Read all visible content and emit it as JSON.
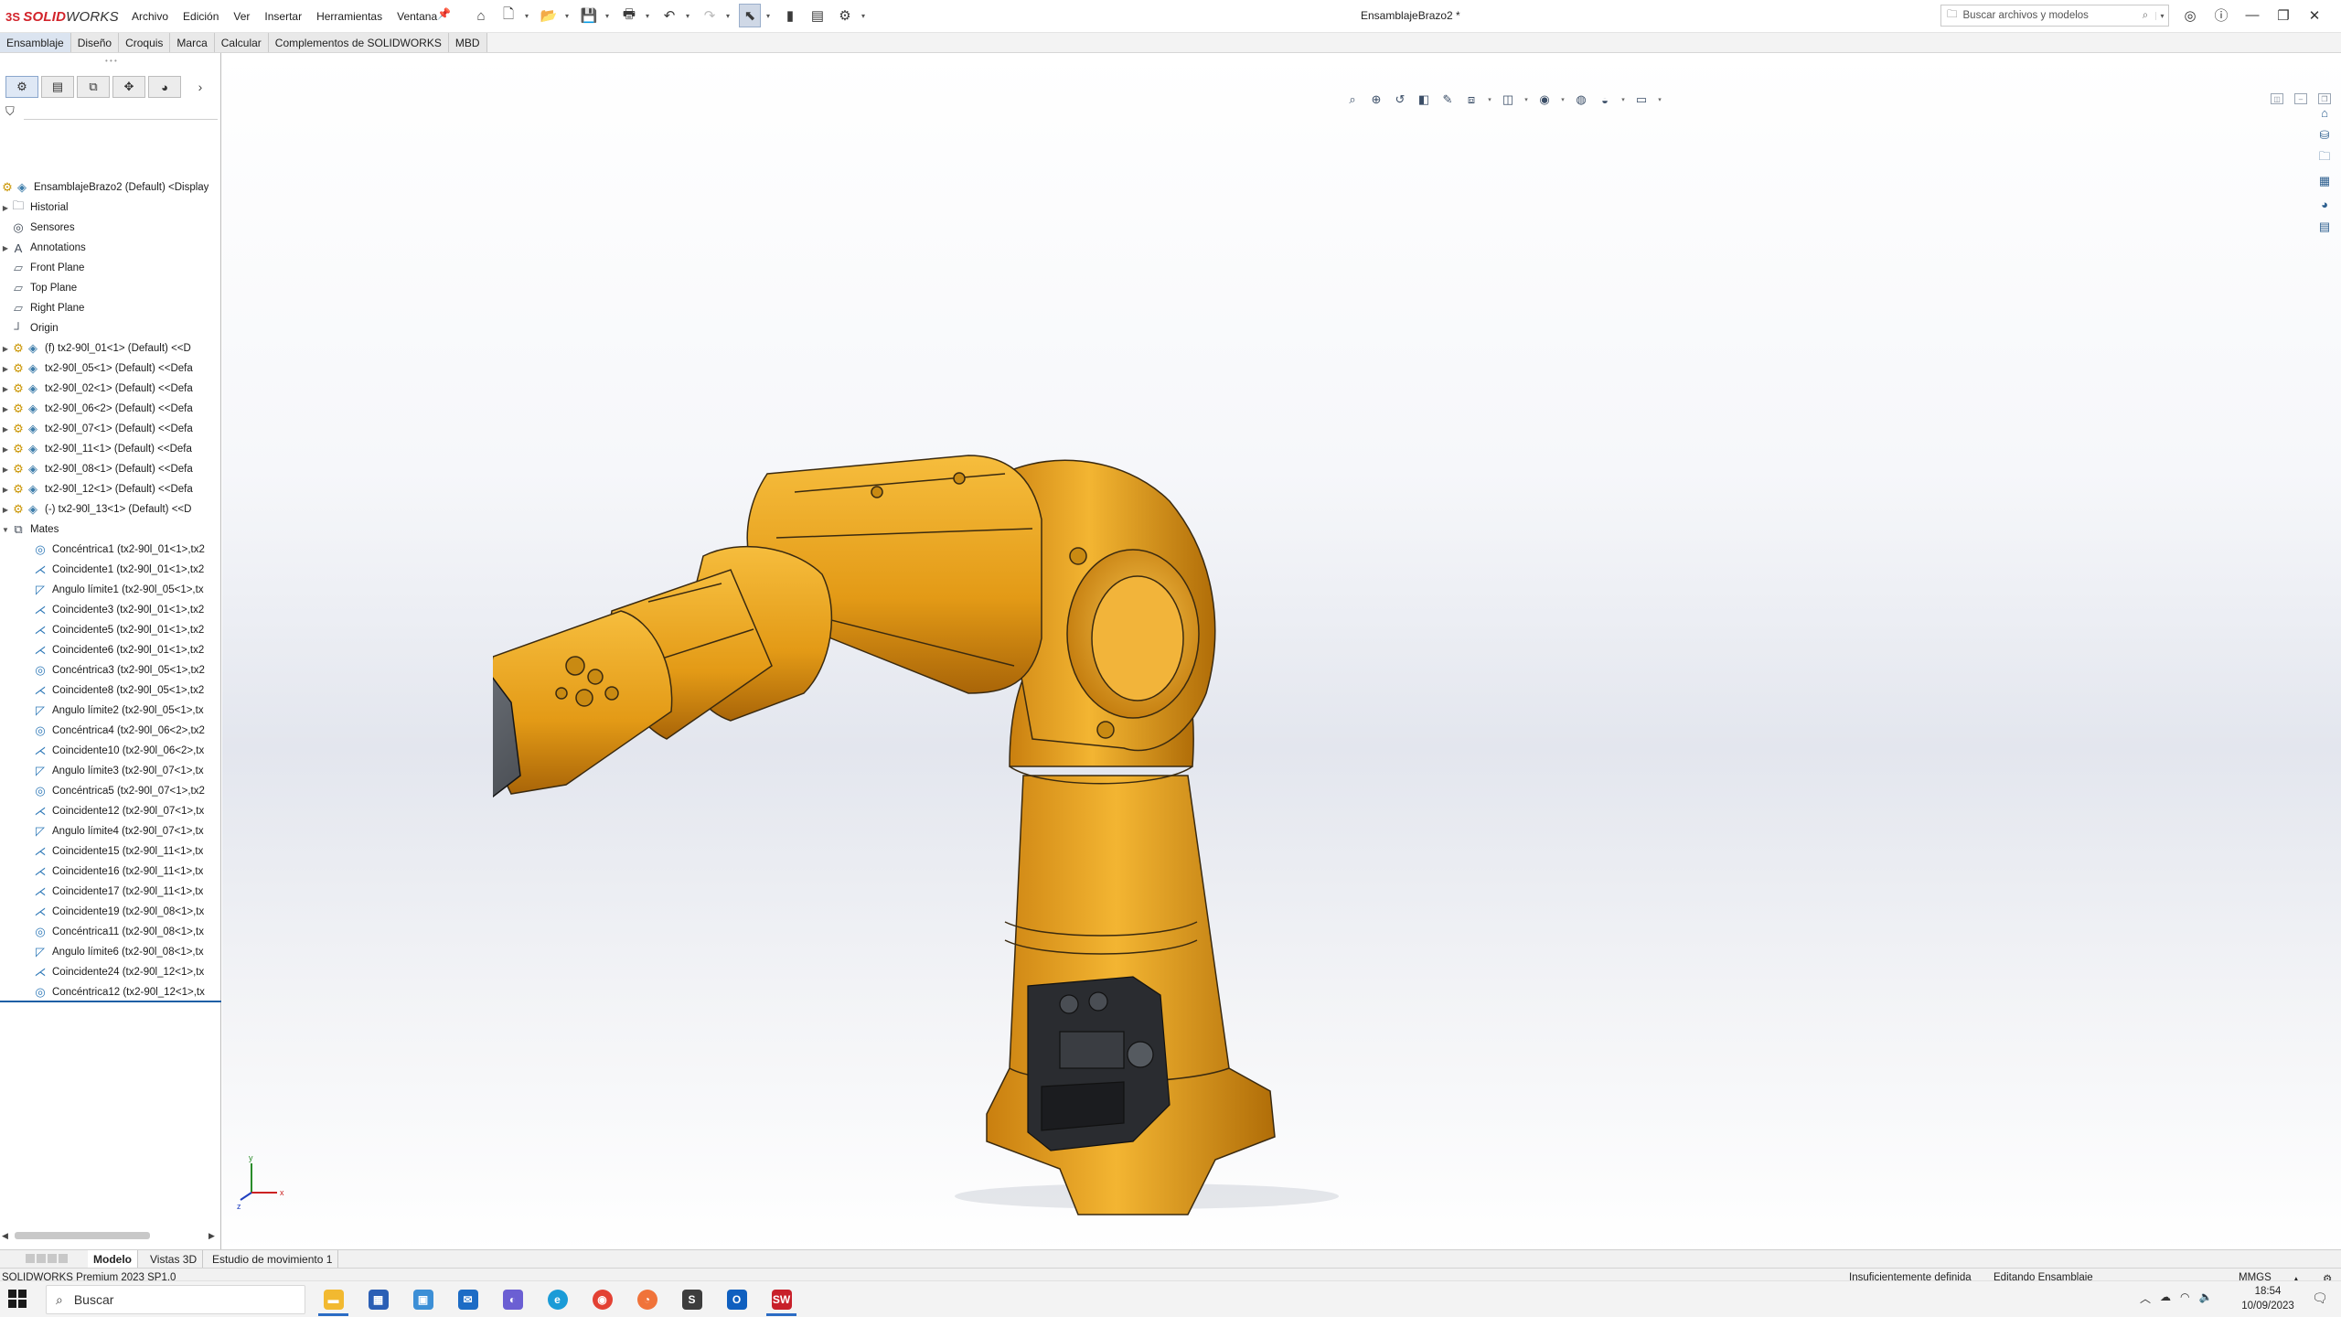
{
  "app": {
    "logo_prefix": "3S",
    "logo_solid": "SOLID",
    "logo_works": "WORKS",
    "document_title": "EnsamblajeBrazo2 *"
  },
  "menu": [
    "Archivo",
    "Edición",
    "Ver",
    "Insertar",
    "Herramientas",
    "Ventana"
  ],
  "search": {
    "placeholder": "Buscar archivos y modelos"
  },
  "command_tabs": [
    "Ensamblaje",
    "Diseño",
    "Croquis",
    "Marca",
    "Calcular",
    "Complementos de SOLIDWORKS",
    "MBD"
  ],
  "tree": {
    "root": "EnsamblajeBrazo2 (Default) <Display",
    "items": [
      {
        "label": "Historial",
        "icon": "history-folder-icon",
        "exp": "▶"
      },
      {
        "label": "Sensores",
        "icon": "sensor-icon",
        "exp": ""
      },
      {
        "label": "Annotations",
        "icon": "annotations-icon",
        "exp": "▶"
      },
      {
        "label": "Front Plane",
        "icon": "plane-icon",
        "exp": ""
      },
      {
        "label": "Top Plane",
        "icon": "plane-icon",
        "exp": ""
      },
      {
        "label": "Right Plane",
        "icon": "plane-icon",
        "exp": ""
      },
      {
        "label": "Origin",
        "icon": "origin-icon",
        "exp": ""
      },
      {
        "label": "(f) tx2-90l_01<1> (Default) <<D",
        "icon": "part-icon",
        "exp": "▶"
      },
      {
        "label": "tx2-90l_05<1> (Default) <<Defa",
        "icon": "part-icon",
        "exp": "▶"
      },
      {
        "label": "tx2-90l_02<1> (Default) <<Defa",
        "icon": "part-icon",
        "exp": "▶"
      },
      {
        "label": "tx2-90l_06<2> (Default) <<Defa",
        "icon": "part-icon",
        "exp": "▶"
      },
      {
        "label": "tx2-90l_07<1> (Default) <<Defa",
        "icon": "part-icon",
        "exp": "▶"
      },
      {
        "label": "tx2-90l_11<1> (Default) <<Defa",
        "icon": "part-icon",
        "exp": "▶"
      },
      {
        "label": "tx2-90l_08<1> (Default) <<Defa",
        "icon": "part-icon",
        "exp": "▶"
      },
      {
        "label": "tx2-90l_12<1> (Default) <<Defa",
        "icon": "part-icon",
        "exp": "▶"
      },
      {
        "label": "(-) tx2-90l_13<1> (Default) <<D",
        "icon": "part-icon",
        "exp": "▶"
      },
      {
        "label": "Mates",
        "icon": "mates-folder-icon",
        "exp": "▼"
      }
    ],
    "mates": [
      {
        "label": "Concéntrica1 (tx2-90l_01<1>,tx2",
        "icon": "concentric-mate-icon"
      },
      {
        "label": "Coincidente1 (tx2-90l_01<1>,tx2",
        "icon": "coincident-mate-icon"
      },
      {
        "label": "Ángulo límite1 (tx2-90l_05<1>,tx",
        "icon": "angle-limit-mate-icon"
      },
      {
        "label": "Coincidente3 (tx2-90l_01<1>,tx2",
        "icon": "coincident-mate-icon"
      },
      {
        "label": "Coincidente5 (tx2-90l_01<1>,tx2",
        "icon": "coincident-mate-icon"
      },
      {
        "label": "Coincidente6 (tx2-90l_01<1>,tx2",
        "icon": "coincident-mate-icon"
      },
      {
        "label": "Concéntrica3 (tx2-90l_05<1>,tx2",
        "icon": "concentric-mate-icon"
      },
      {
        "label": "Coincidente8 (tx2-90l_05<1>,tx2",
        "icon": "coincident-mate-icon"
      },
      {
        "label": "Ángulo límite2 (tx2-90l_05<1>,tx",
        "icon": "angle-limit-mate-icon"
      },
      {
        "label": "Concéntrica4 (tx2-90l_06<2>,tx2",
        "icon": "concentric-mate-icon"
      },
      {
        "label": "Coincidente10 (tx2-90l_06<2>,tx",
        "icon": "coincident-mate-icon"
      },
      {
        "label": "Ángulo límite3 (tx2-90l_07<1>,tx",
        "icon": "angle-limit-mate-icon"
      },
      {
        "label": "Concéntrica5 (tx2-90l_07<1>,tx2",
        "icon": "concentric-mate-icon"
      },
      {
        "label": "Coincidente12 (tx2-90l_07<1>,tx",
        "icon": "coincident-mate-icon"
      },
      {
        "label": "Ángulo límite4 (tx2-90l_07<1>,tx",
        "icon": "angle-limit-mate-icon"
      },
      {
        "label": "Coincidente15 (tx2-90l_11<1>,tx",
        "icon": "coincident-mate-icon"
      },
      {
        "label": "Coincidente16 (tx2-90l_11<1>,tx",
        "icon": "coincident-mate-icon"
      },
      {
        "label": "Coincidente17 (tx2-90l_11<1>,tx",
        "icon": "coincident-mate-icon"
      },
      {
        "label": "Coincidente19 (tx2-90l_08<1>,tx",
        "icon": "coincident-mate-icon"
      },
      {
        "label": "Concéntrica11 (tx2-90l_08<1>,tx",
        "icon": "concentric-mate-icon"
      },
      {
        "label": "Ángulo límite6 (tx2-90l_08<1>,tx",
        "icon": "angle-limit-mate-icon"
      },
      {
        "label": "Coincidente24 (tx2-90l_12<1>,tx",
        "icon": "coincident-mate-icon"
      },
      {
        "label": "Concéntrica12 (tx2-90l_12<1>,tx",
        "icon": "concentric-mate-icon"
      }
    ]
  },
  "bottom_tabs": [
    "Modelo",
    "Vistas 3D",
    "Estudio de movimiento 1"
  ],
  "status": {
    "product": "SOLIDWORKS Premium 2023 SP1.0",
    "definition": "Insuficientemente definida",
    "mode": "Editando Ensamblaje",
    "units": "MMGS"
  },
  "taskbar": {
    "search_label": "Buscar",
    "time": "18:54",
    "date": "10/09/2023"
  },
  "triad": {
    "x": "x",
    "y": "y",
    "z": "z"
  },
  "colors": {
    "robot_body": "#e9a019",
    "robot_shadow": "#a7650a",
    "gripper": "#555a60",
    "accent": "#1d5fa5"
  }
}
